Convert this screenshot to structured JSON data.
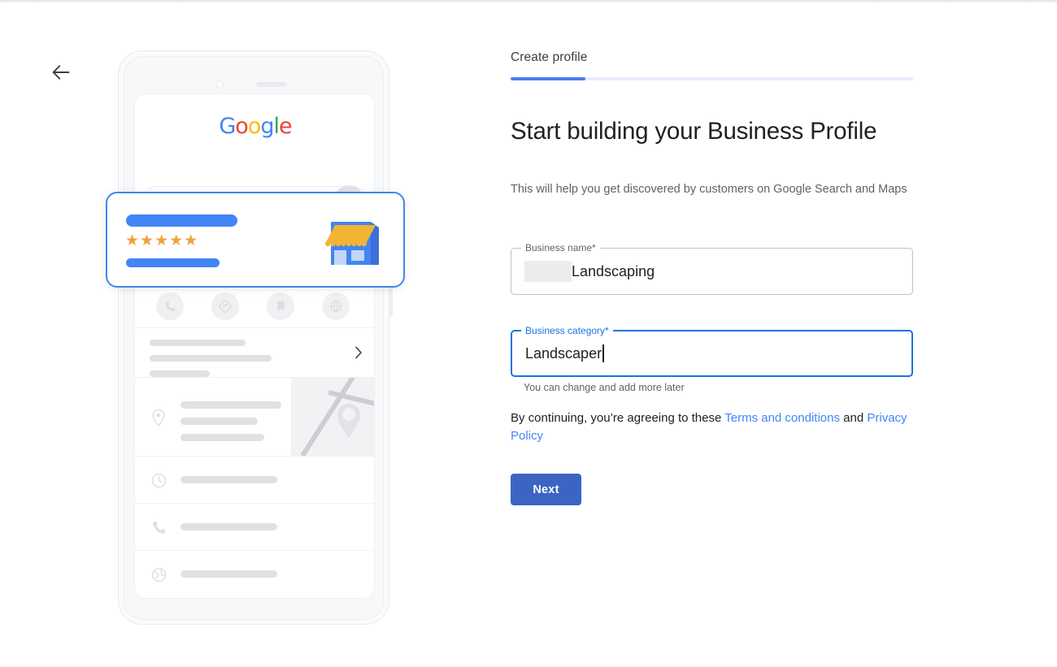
{
  "window": {
    "back_arrow_icon": "arrow-left-icon"
  },
  "panel": {
    "step_label": "Create profile",
    "progress_percent": 18.5,
    "headline": "Start building your Business Profile",
    "subtext": "This will help you get discovered by customers on Google Search and Maps",
    "fields": [
      {
        "id": "business-name",
        "legend": "Business name*",
        "value": "Landscaping",
        "redacted_prefix": true,
        "focused": false
      },
      {
        "id": "business-category",
        "legend": "Business category*",
        "value": "Landscaper",
        "redacted_prefix": false,
        "focused": true,
        "helper": "You can change and add more later"
      }
    ],
    "legal": {
      "prefix": "By continuing, you’re agreeing to these ",
      "terms_link": "Terms and conditions",
      "middle": " and ",
      "privacy_link": "Privacy Policy"
    },
    "next_button": "Next"
  },
  "illustration": {
    "phone": {
      "google_logo": [
        {
          "char": "G",
          "color": "#4285F4"
        },
        {
          "char": "o",
          "color": "#EA4335"
        },
        {
          "char": "o",
          "color": "#FBBC05"
        },
        {
          "char": "g",
          "color": "#4285F4"
        },
        {
          "char": "l",
          "color": "#34A853"
        },
        {
          "char": "e",
          "color": "#EA4335"
        }
      ],
      "search_icon": "search-icon",
      "chips": [
        4
      ],
      "action_icons": [
        "phone-icon",
        "directions-icon",
        "bookmark-icon",
        "website-icon"
      ],
      "list_rows": [
        {
          "icon": "location-pin-icon",
          "has_map": true
        },
        {
          "icon": "clock-icon",
          "has_map": false
        },
        {
          "icon": "phone-icon",
          "has_map": false
        },
        {
          "icon": "globe-icon",
          "has_map": false
        }
      ],
      "chevron_icon": "chevron-right-icon"
    },
    "overlay_card": {
      "stars": "★★★★★",
      "star_count": 5,
      "star_color": "#F0A33A",
      "storefront_icon": "storefront-icon",
      "accent_color": "#4285F4"
    }
  },
  "colors": {
    "google_blue": "#4285F4",
    "focus_blue": "#1a73e8",
    "button_blue": "#3b64c4",
    "progress_fill": "#4c7df0",
    "progress_track": "#e8eefc",
    "text_primary": "#202124",
    "text_secondary": "#5f6368",
    "star_orange": "#F0A33A",
    "awning_yellow": "#F2B434"
  }
}
